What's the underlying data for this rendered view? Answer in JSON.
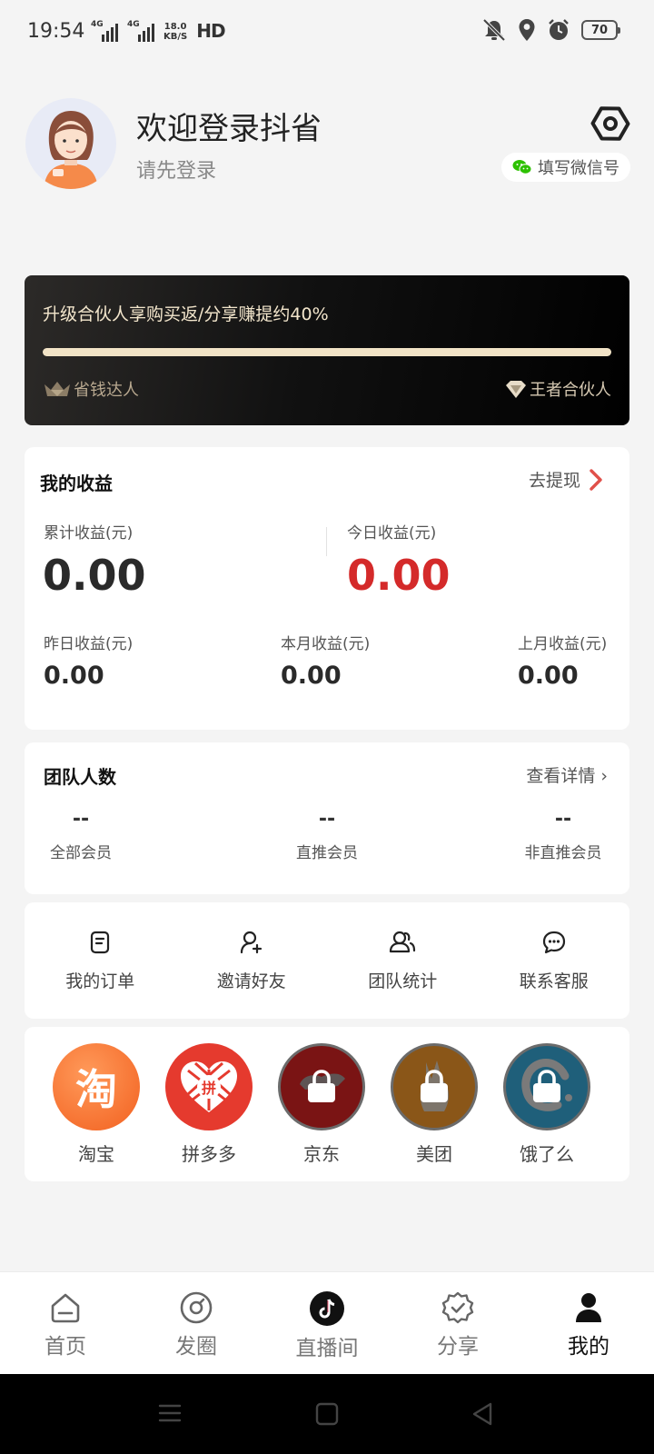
{
  "status_bar": {
    "time": "19:54",
    "net_type_1": "4G",
    "net_type_2": "4G",
    "speed_value": "18.0",
    "speed_unit": "KB/S",
    "hd_label": "HD",
    "battery": "70"
  },
  "profile": {
    "title": "欢迎登录抖省",
    "subtitle": "请先登录",
    "wechat_button": "填写微信号"
  },
  "partner_banner": {
    "title": "升级合伙人享购买返/分享赚提约40%",
    "progress": 1.0,
    "level_current": "省钱达人",
    "level_next": "王者合伙人"
  },
  "earnings": {
    "title": "我的收益",
    "withdraw_label": "去提现",
    "total_label": "累计收益(元)",
    "total_value": "0.00",
    "today_label": "今日收益(元)",
    "today_value": "0.00",
    "yesterday_label": "昨日收益(元)",
    "yesterday_value": "0.00",
    "month_label": "本月收益(元)",
    "month_value": "0.00",
    "last_month_label": "上月收益(元)",
    "last_month_value": "0.00",
    "accent_color": "#d42a2a"
  },
  "team": {
    "title": "团队人数",
    "details_label": "查看详情 ›",
    "stats": [
      {
        "value": "--",
        "label": "全部会员"
      },
      {
        "value": "--",
        "label": "直推会员"
      },
      {
        "value": "--",
        "label": "非直推会员"
      }
    ]
  },
  "tools": [
    {
      "label": "我的订单",
      "icon": "order-icon"
    },
    {
      "label": "邀请好友",
      "icon": "invite-friend-icon"
    },
    {
      "label": "团队统计",
      "icon": "team-stats-icon"
    },
    {
      "label": "联系客服",
      "icon": "customer-service-icon"
    }
  ],
  "platforms": [
    {
      "label": "淘宝",
      "logo_text": "淘",
      "locked": false,
      "color": "#f26a2e"
    },
    {
      "label": "拼多多",
      "logo_text": "拼",
      "locked": false,
      "color": "#e02e24"
    },
    {
      "label": "京东",
      "locked": true,
      "color": "#7a1414"
    },
    {
      "label": "美团",
      "locked": true,
      "color": "#8a5618"
    },
    {
      "label": "饿了么",
      "locked": true,
      "color": "#1f5f7a"
    }
  ],
  "bottom_nav": [
    {
      "label": "首页",
      "icon": "home-icon",
      "active": false
    },
    {
      "label": "发圈",
      "icon": "circle-post-icon",
      "active": false
    },
    {
      "label": "直播间",
      "icon": "tiktok-icon",
      "active": false
    },
    {
      "label": "分享",
      "icon": "share-badge-icon",
      "active": false
    },
    {
      "label": "我的",
      "icon": "profile-icon",
      "active": true
    }
  ]
}
